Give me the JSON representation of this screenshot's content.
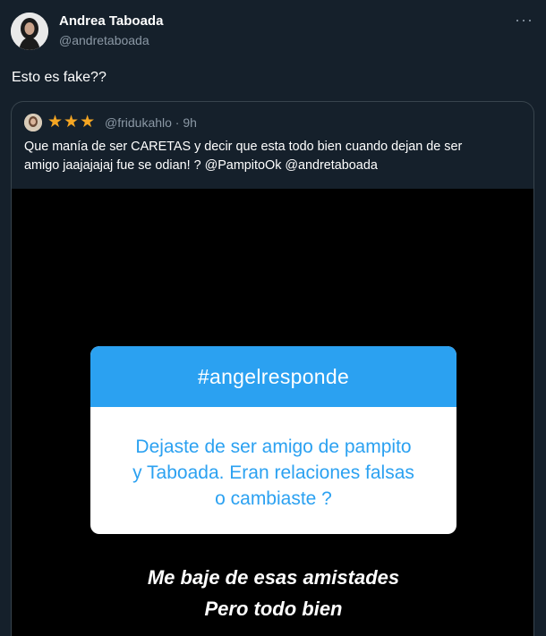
{
  "tweet": {
    "author_name": "Andrea Taboada",
    "author_handle": "@andretaboada",
    "more_icon": "more-icon",
    "text": "Esto es fake??"
  },
  "quote": {
    "stars": "★★★",
    "handle_time": "@fridukahlo · 9h",
    "text_line1": "Que manía de ser CARETAS y decir que esta todo bien cuando dejan de ser",
    "text_line2": "amigo jaajajajaj fue se odian! ? @PampitoOk @andretaboada",
    "media": {
      "story_tag": "#angelresponde",
      "question_line1": "Dejaste de ser amigo de pampito",
      "question_line2": "y Taboada. Eran relaciones falsas",
      "question_line3": "o cambiaste ?",
      "answer_line1": "Me baje de esas amistades",
      "answer_line2": "Pero todo bien"
    }
  },
  "colors": {
    "background": "#15202b",
    "secondary_text": "#8b98a5",
    "story_blue": "#2ba1f1",
    "star": "#f5a623"
  }
}
